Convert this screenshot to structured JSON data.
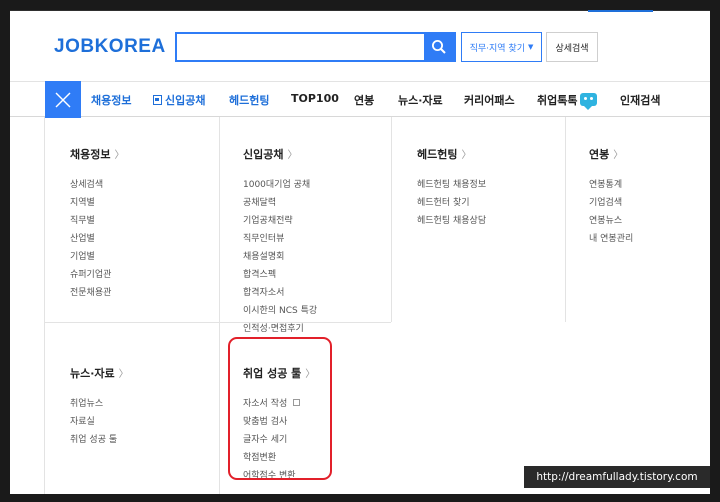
{
  "header": {
    "logo": "JOBKOREA",
    "search": {
      "value": "",
      "placeholder": ""
    },
    "job_region_label": "직무·지역 찾기",
    "detail_search_label": "상세검색"
  },
  "nav": {
    "items": [
      {
        "label": "채용정보"
      },
      {
        "label": "신입공채"
      },
      {
        "label": "헤드헌팅"
      },
      {
        "label": "TOP100"
      },
      {
        "label": "연봉"
      },
      {
        "label": "뉴스·자료"
      },
      {
        "label": "커리어패스"
      },
      {
        "label": "취업톡톡"
      },
      {
        "label": "인재검색"
      }
    ]
  },
  "menu": {
    "hiring": {
      "title": "채용정보",
      "items": [
        "상세검색",
        "지역별",
        "직무별",
        "산업별",
        "기업별",
        "슈퍼기업관",
        "전문채용관"
      ]
    },
    "newgrad": {
      "title": "신입공채",
      "items": [
        "1000대기업 공채",
        "공채달력",
        "기업공채전략",
        "직무인터뷰",
        "채용설명회",
        "합격스펙",
        "합격자소서",
        "이시한의 NCS 특강",
        "인적성·면접후기"
      ]
    },
    "headhunting": {
      "title": "헤드헌팅",
      "items": [
        "헤드헌팅 채용정보",
        "헤드헌터 찾기",
        "헤드헌팅 채용상담"
      ]
    },
    "salary": {
      "title": "연봉",
      "items": [
        "연봉통계",
        "기업검색",
        "연봉뉴스",
        "내 연봉관리"
      ]
    },
    "news": {
      "title": "뉴스·자료",
      "items": [
        "취업뉴스",
        "자료실",
        "취업 성공 툴"
      ]
    },
    "tools": {
      "title": "취업 성공 툴",
      "items": [
        "자소서 작성",
        "맞춤법 검사",
        "글자수 세기",
        "학점변환",
        "어학점수 변환"
      ]
    }
  },
  "watermark": "http://dreamfullady.tistory.com",
  "colors": {
    "brand": "#1e6fd9",
    "accent": "#2f7cf6",
    "highlight": "#e2202a"
  }
}
